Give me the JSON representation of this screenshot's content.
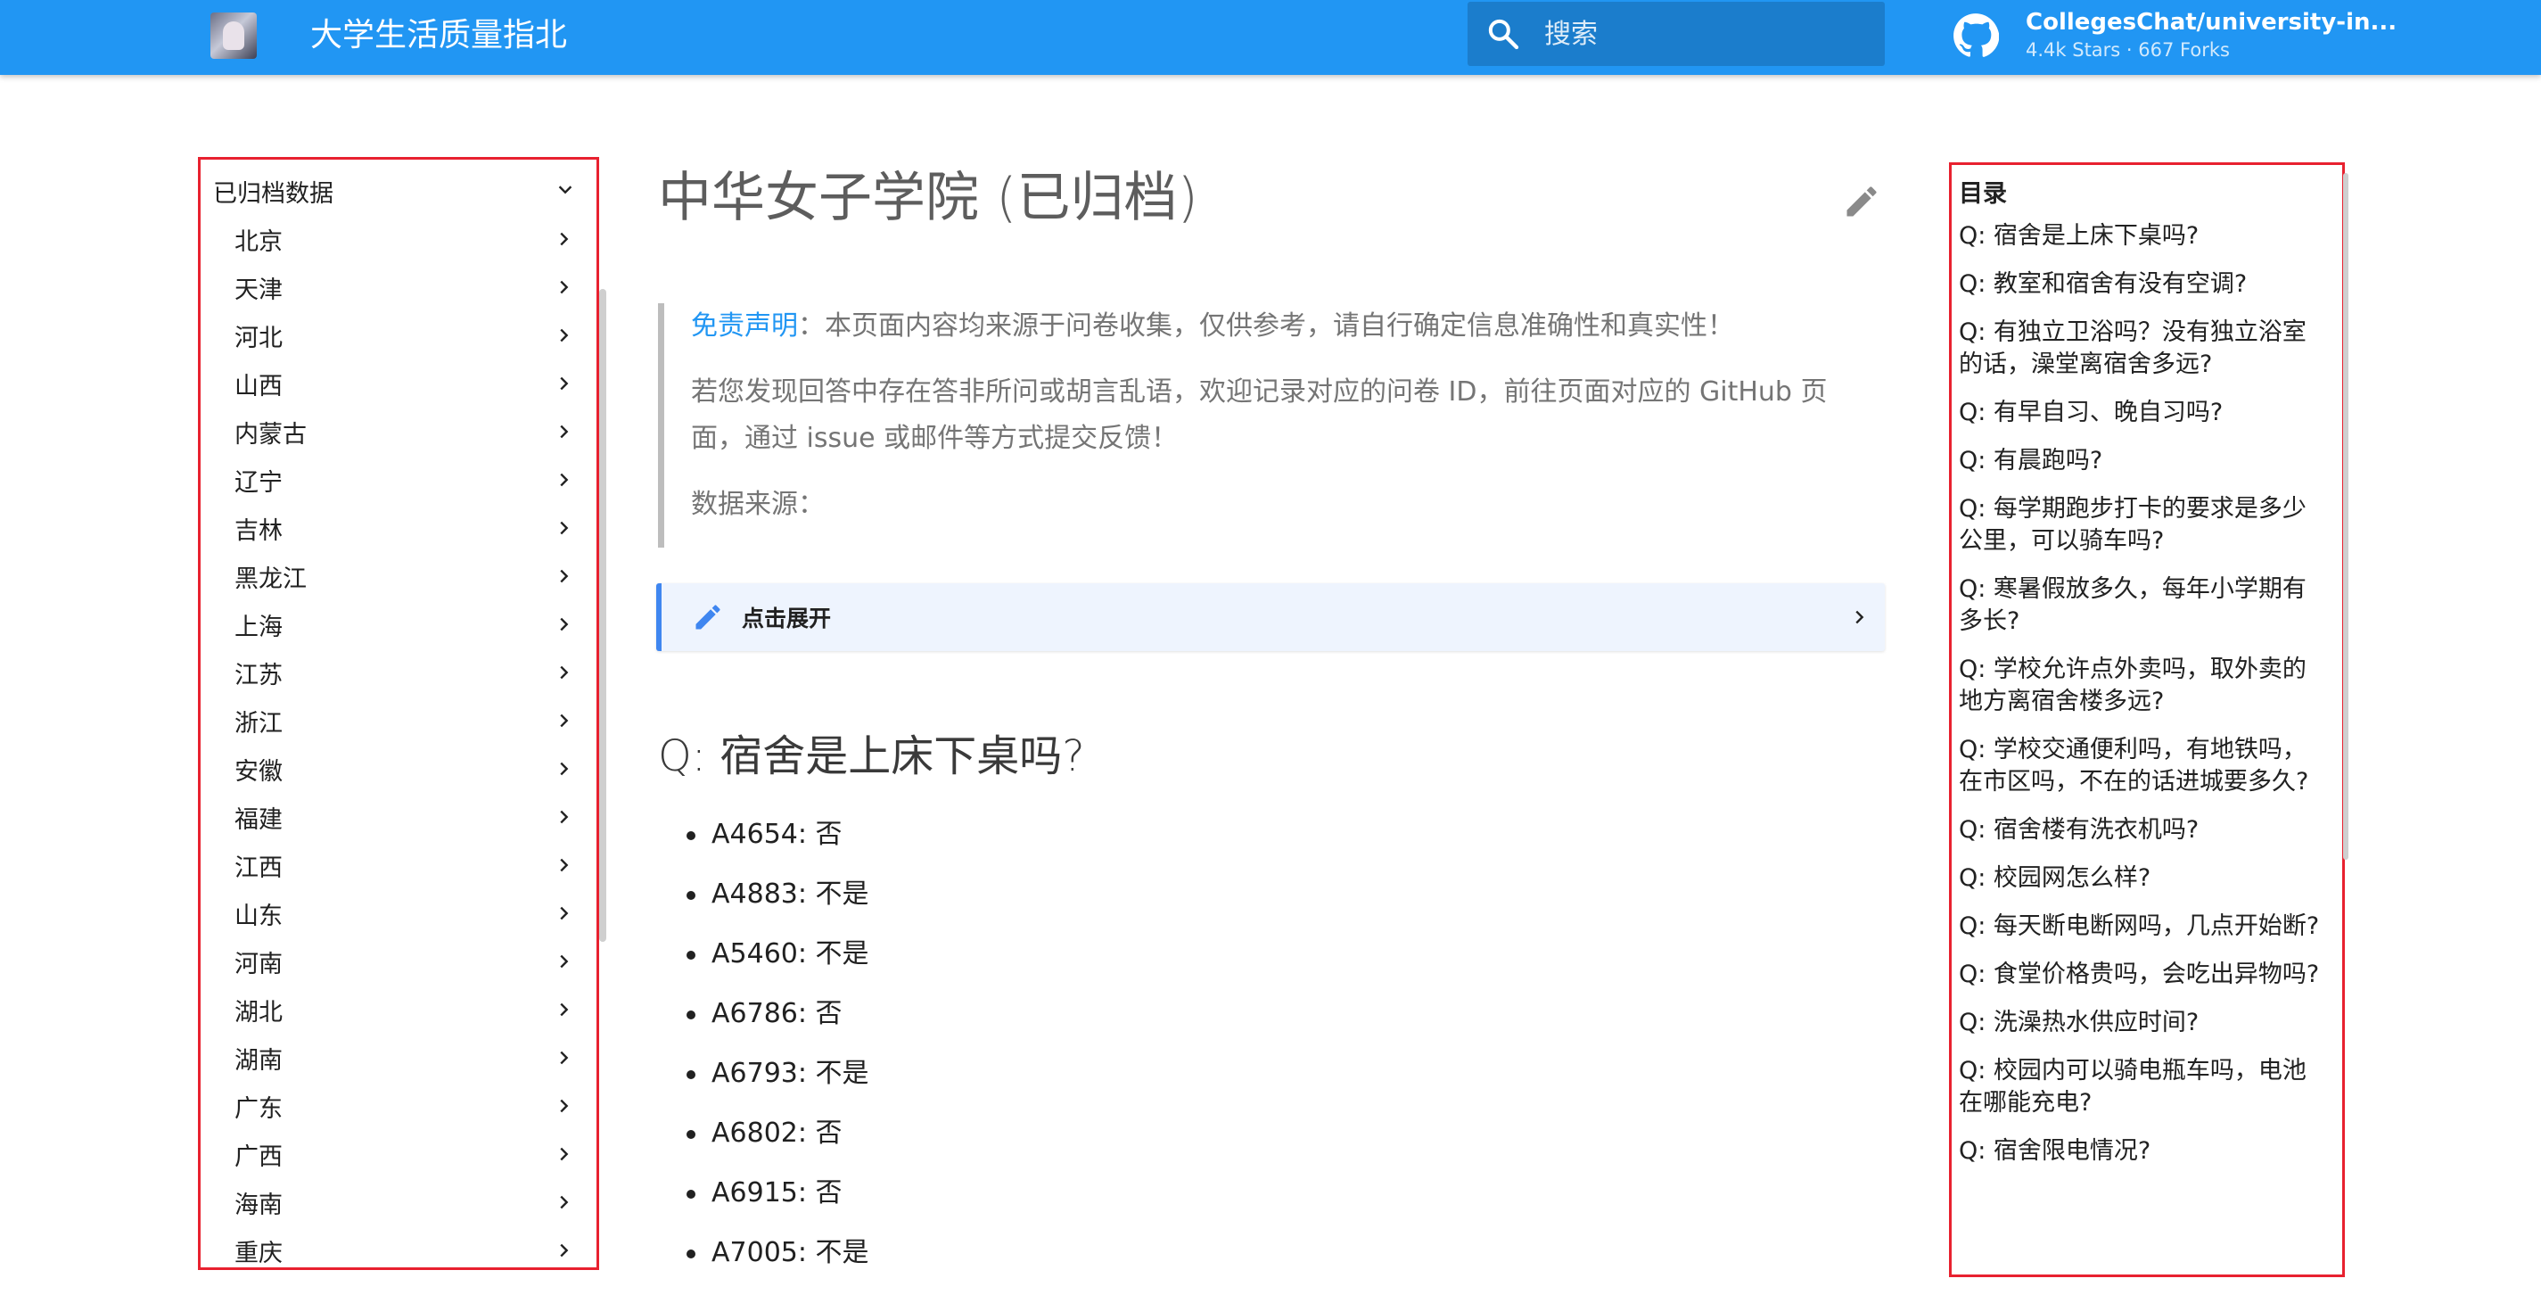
{
  "header": {
    "site_title": "大学生活质量指北",
    "search_placeholder": "搜索",
    "repo_name": "CollegesChat/university-in...",
    "repo_stats": "4.4k Stars · 667 Forks"
  },
  "left_nav": {
    "section_label": "已归档数据",
    "items": [
      "北京",
      "天津",
      "河北",
      "山西",
      "内蒙古",
      "辽宁",
      "吉林",
      "黑龙江",
      "上海",
      "江苏",
      "浙江",
      "安徽",
      "福建",
      "江西",
      "山东",
      "河南",
      "湖北",
      "湖南",
      "广东",
      "广西",
      "海南",
      "重庆"
    ]
  },
  "main": {
    "title": "中华女子学院 (已归档)",
    "disclaimer_link": "免责声明",
    "disclaimer_text": "：本页面内容均来源于问卷收集，仅供参考，请自行确定信息准确性和真实性！",
    "feedback_text": "若您发现回答中存在答非所问或胡言乱语，欢迎记录对应的问卷 ID，前往页面对应的 GitHub 页面，通过 issue 或邮件等方式提交反馈！",
    "source_text": "数据来源：",
    "expand_label": "点击展开",
    "question": "Q: 宿舍是上床下桌吗?",
    "answers": [
      "A4654: 否",
      "A4883: 不是",
      "A5460: 不是",
      "A6786: 否",
      "A6793: 不是",
      "A6802: 否",
      "A6915: 否",
      "A7005: 不是"
    ]
  },
  "toc": {
    "title": "目录",
    "items": [
      "Q: 宿舍是上床下桌吗?",
      "Q: 教室和宿舍有没有空调?",
      "Q: 有独立卫浴吗？没有独立浴室的话，澡堂离宿舍多远?",
      "Q: 有早自习、晚自习吗?",
      "Q: 有晨跑吗?",
      "Q: 每学期跑步打卡的要求是多少公里，可以骑车吗?",
      "Q: 寒暑假放多久，每年小学期有多长?",
      "Q: 学校允许点外卖吗，取外卖的地方离宿舍楼多远?",
      "Q: 学校交通便利吗，有地铁吗，在市区吗，不在的话进城要多久?",
      "Q: 宿舍楼有洗衣机吗?",
      "Q: 校园网怎么样?",
      "Q: 每天断电断网吗，几点开始断?",
      "Q: 食堂价格贵吗，会吃出异物吗?",
      "Q: 洗澡热水供应时间?",
      "Q: 校园内可以骑电瓶车吗，电池在哪能充电?",
      "Q: 宿舍限电情况?"
    ]
  }
}
